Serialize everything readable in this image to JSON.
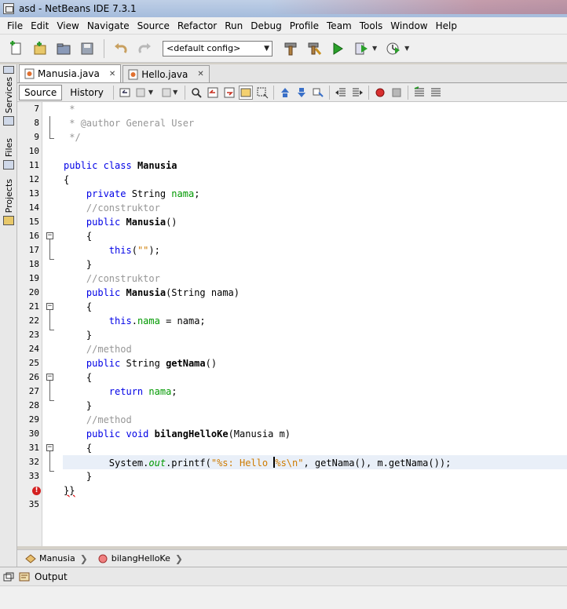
{
  "window": {
    "title": "asd - NetBeans IDE 7.3.1"
  },
  "menu": [
    "File",
    "Edit",
    "View",
    "Navigate",
    "Source",
    "Refactor",
    "Run",
    "Debug",
    "Profile",
    "Team",
    "Tools",
    "Window",
    "Help"
  ],
  "toolbar": {
    "config_value": "<default config>"
  },
  "sidebar": {
    "services": "Services",
    "files": "Files",
    "projects": "Projects"
  },
  "tabs": [
    {
      "label": "Manusia.java",
      "active": true
    },
    {
      "label": "Hello.java",
      "active": false
    }
  ],
  "editor_toolbar": {
    "source": "Source",
    "history": "History"
  },
  "code_lines": [
    {
      "n": "7",
      "text": " *"
    },
    {
      "n": "8",
      "text": " * @author General User"
    },
    {
      "n": "9",
      "text": " */"
    },
    {
      "n": "10",
      "text": ""
    },
    {
      "n": "11",
      "text": "public class Manusia"
    },
    {
      "n": "12",
      "text": "{"
    },
    {
      "n": "13",
      "text": "    private String nama;"
    },
    {
      "n": "14",
      "text": "    //construktor"
    },
    {
      "n": "15",
      "text": "    public Manusia()"
    },
    {
      "n": "16",
      "text": "    {"
    },
    {
      "n": "17",
      "text": "        this(\"\");"
    },
    {
      "n": "18",
      "text": "    }"
    },
    {
      "n": "19",
      "text": "    //construktor"
    },
    {
      "n": "20",
      "text": "    public Manusia(String nama)"
    },
    {
      "n": "21",
      "text": "    {"
    },
    {
      "n": "22",
      "text": "        this.nama = nama;"
    },
    {
      "n": "23",
      "text": "    }"
    },
    {
      "n": "24",
      "text": "    //method"
    },
    {
      "n": "25",
      "text": "    public String getNama()"
    },
    {
      "n": "26",
      "text": "    {"
    },
    {
      "n": "27",
      "text": "        return nama;"
    },
    {
      "n": "28",
      "text": "    }"
    },
    {
      "n": "29",
      "text": "    //method"
    },
    {
      "n": "30",
      "text": "    public void bilangHelloKe(Manusia m)"
    },
    {
      "n": "31",
      "text": "    {"
    },
    {
      "n": "32",
      "text": "        System.out.printf(\"%s: Hello %s\\n\", getNama(), m.getNama());"
    },
    {
      "n": "33",
      "text": "    }"
    },
    {
      "n": "",
      "text": "}}"
    },
    {
      "n": "35",
      "text": ""
    }
  ],
  "breadcrumbs": [
    "Manusia",
    "bilangHelloKe"
  ],
  "output": {
    "label": "Output"
  },
  "colors": {
    "keyword": "#0000e6",
    "comment": "#969696",
    "field": "#009900",
    "string": "#ce7b00",
    "current_line": "#e9eff8",
    "error": "#d42020"
  }
}
